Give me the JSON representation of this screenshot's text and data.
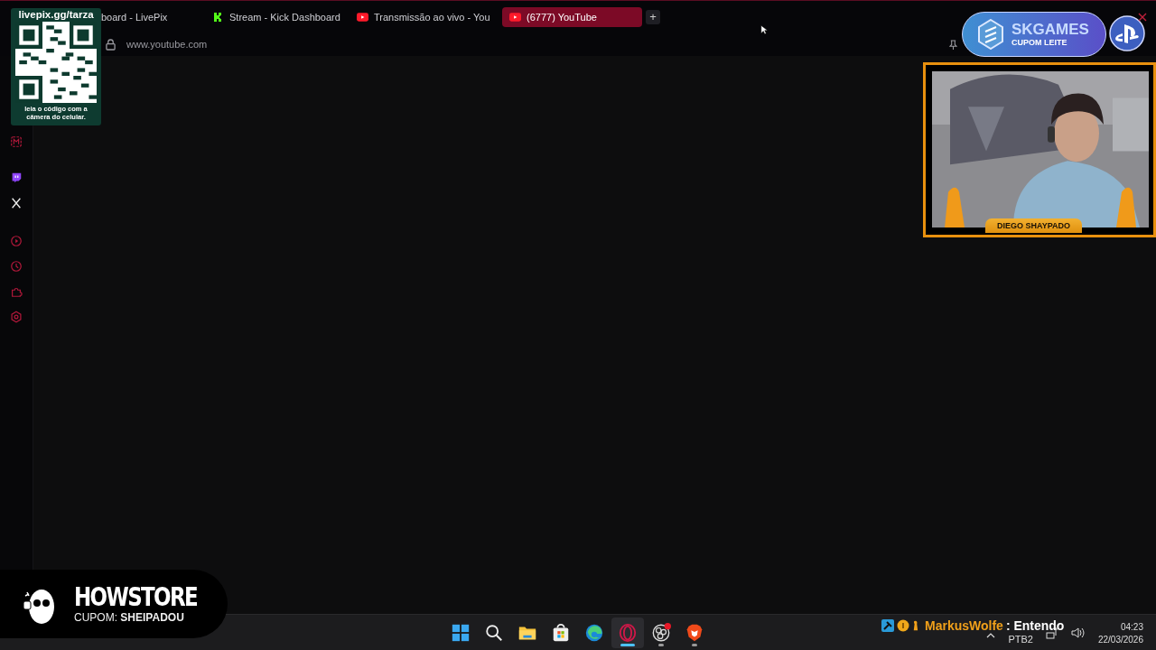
{
  "qr_overlay": {
    "title": "livepix.gg/tarza",
    "caption": "leia o código com a câmera do celular."
  },
  "browser": {
    "tabs": [
      {
        "label": "board - LivePix",
        "kind": "plain",
        "selected": false
      },
      {
        "label": "Stream - Kick Dashboard",
        "kind": "kick",
        "selected": false
      },
      {
        "label": "Transmissão ao vivo - You",
        "kind": "youtube",
        "selected": false
      },
      {
        "label": "(6777) YouTube",
        "kind": "youtube",
        "selected": true
      }
    ],
    "new_tab": "+",
    "address": "www.youtube.com",
    "sidebar": [
      {
        "kind": "messenger"
      },
      {
        "kind": "twitch"
      },
      {
        "kind": "x"
      },
      {
        "kind": "player"
      },
      {
        "kind": "history"
      },
      {
        "kind": "extensions"
      },
      {
        "kind": "settings"
      }
    ]
  },
  "sponsor_top": {
    "title": "SKGAMES",
    "subtitle": "CUPOM LEITE"
  },
  "webcam": {
    "kind": "picture",
    "name": "DIEGO SHAYPADO"
  },
  "sponsor_bottom": {
    "title": "HOWSTORE",
    "coupon": "CUPOM: **SHEIPADOU**"
  },
  "chat": {
    "user": "MarkusWolfe",
    "message": ": Entendo"
  },
  "taskbar": {
    "apps": [
      {
        "kind": "start",
        "selected": false,
        "running": false,
        "badge": false
      },
      {
        "kind": "search",
        "selected": false,
        "running": false,
        "badge": false
      },
      {
        "kind": "files",
        "selected": false,
        "running": false,
        "badge": false
      },
      {
        "kind": "store",
        "selected": false,
        "running": false,
        "badge": false
      },
      {
        "kind": "edge",
        "selected": false,
        "running": false,
        "badge": false
      },
      {
        "kind": "opera",
        "selected": true,
        "running": true,
        "badge": false
      },
      {
        "kind": "obs",
        "selected": false,
        "running": true,
        "badge": true
      },
      {
        "kind": "brave",
        "selected": false,
        "running": true,
        "badge": false
      }
    ],
    "language": "PTB2",
    "time": "04:23",
    "date": "22/03/2026"
  }
}
